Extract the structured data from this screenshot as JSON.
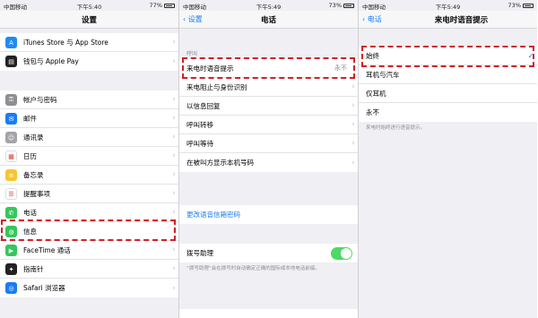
{
  "status": {
    "carrier": "中国移动",
    "panel1_time": "下午5:40",
    "panel1_battery": "77%",
    "panel2_time": "下午5:49",
    "panel2_battery": "73%",
    "panel3_time": "下午5:49",
    "panel3_battery": "73%"
  },
  "panel1": {
    "title": "设置",
    "group1": [
      {
        "label": "iTunes Store 与 App Store",
        "icon": "app-store-icon",
        "color": "#1f8bf5",
        "glyph": "A"
      },
      {
        "label": "钱包与 Apple Pay",
        "icon": "wallet-icon",
        "color": "#222222",
        "glyph": "▤"
      }
    ],
    "group2": [
      {
        "label": "帐户与密码",
        "icon": "key-icon",
        "color": "#8e8e93",
        "glyph": "⚿"
      },
      {
        "label": "邮件",
        "icon": "mail-icon",
        "color": "#1a7cf5",
        "glyph": "✉"
      },
      {
        "label": "通讯录",
        "icon": "contacts-icon",
        "color": "#a3a3a8",
        "glyph": "☺"
      },
      {
        "label": "日历",
        "icon": "calendar-icon",
        "color": "#ffffff",
        "glyph": "▦"
      },
      {
        "label": "备忘录",
        "icon": "notes-icon",
        "color": "#f7c530",
        "glyph": "≡"
      },
      {
        "label": "提醒事项",
        "icon": "reminders-icon",
        "color": "#ffffff",
        "glyph": "☰"
      },
      {
        "label": "电话",
        "icon": "phone-icon",
        "color": "#34c759",
        "glyph": "✆"
      },
      {
        "label": "信息",
        "icon": "messages-icon",
        "color": "#34c759",
        "glyph": "◍"
      },
      {
        "label": "FaceTime 通话",
        "icon": "facetime-icon",
        "color": "#34c759",
        "glyph": "▶"
      },
      {
        "label": "指南针",
        "icon": "compass-icon",
        "color": "#222222",
        "glyph": "✦"
      },
      {
        "label": "Safari 浏览器",
        "icon": "safari-icon",
        "color": "#1a7cf5",
        "glyph": "◎"
      }
    ]
  },
  "panel2": {
    "back": "设置",
    "title": "电话",
    "section_header": "呼叫",
    "calls": [
      {
        "label": "来电时语音提示",
        "value": "永不"
      },
      {
        "label": "来电阻止与身份识别",
        "value": ""
      },
      {
        "label": "以信息回复",
        "value": ""
      },
      {
        "label": "呼叫转移",
        "value": ""
      },
      {
        "label": "呼叫等待",
        "value": ""
      },
      {
        "label": "在被叫方显示本机号码",
        "value": ""
      }
    ],
    "voicemail_link": "更改语音信箱密码",
    "dial_assist_label": "拨号助理",
    "dial_assist_on": true,
    "dial_assist_footer": "“拨号助理”会在拨号时自动确定正确的国际或本地电话前缀。"
  },
  "panel3": {
    "back": "电话",
    "title": "来电时语音提示",
    "options": [
      "始终",
      "耳机与汽车",
      "仅耳机",
      "永不"
    ],
    "selected_index": 0,
    "footer": "来电时始终进行语音提示。"
  },
  "colors": {
    "accent": "#1a7cf5",
    "highlight": "#d21f2a",
    "toggle_on": "#4cd964"
  }
}
